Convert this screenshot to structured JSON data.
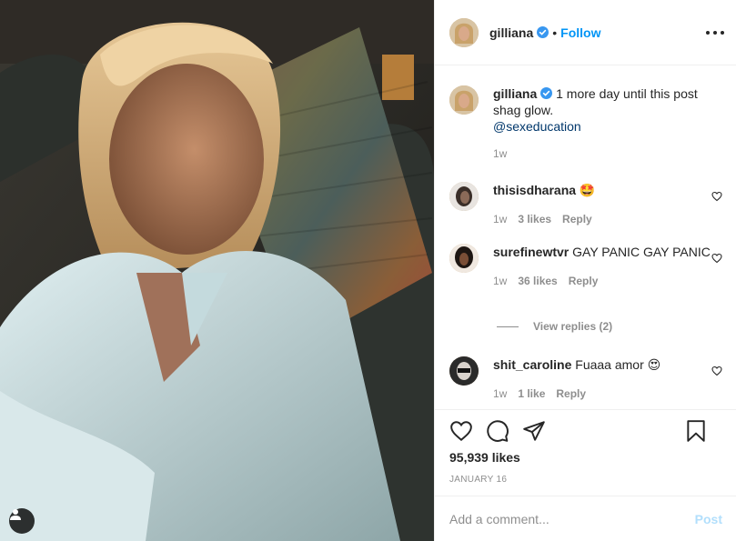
{
  "header": {
    "username": "gilliana",
    "separator": "•",
    "follow_label": "Follow"
  },
  "caption": {
    "username": "gilliana",
    "text": "1 more day until this post shag glow.",
    "mention": "@sexeducation",
    "time": "1w"
  },
  "comments": [
    {
      "username": "thisisdharana",
      "text": "🤩",
      "time": "1w",
      "likes": "3 likes",
      "reply": "Reply"
    },
    {
      "username": "surefinewtvr",
      "text": "GAY PANIC GAY PANIC",
      "time": "1w",
      "likes": "36 likes",
      "reply": "Reply"
    },
    {
      "username": "shit_caroline",
      "text": "Fuaaa amor 😍",
      "time": "1w",
      "likes": "1 like",
      "reply": "Reply"
    }
  ],
  "view_replies": "View replies (2)",
  "stats": {
    "likes": "95,939 likes",
    "date": "JANUARY 16"
  },
  "comment_box": {
    "placeholder": "Add a comment...",
    "post_label": "Post"
  },
  "colors": {
    "accent": "#0095f6",
    "muted": "#8e8e8e",
    "post_disabled": "#b2dffc"
  },
  "icons": [
    "verified-badge-icon",
    "more-options-icon",
    "heart-icon",
    "comment-icon",
    "share-icon",
    "bookmark-icon",
    "user-tag-icon"
  ]
}
